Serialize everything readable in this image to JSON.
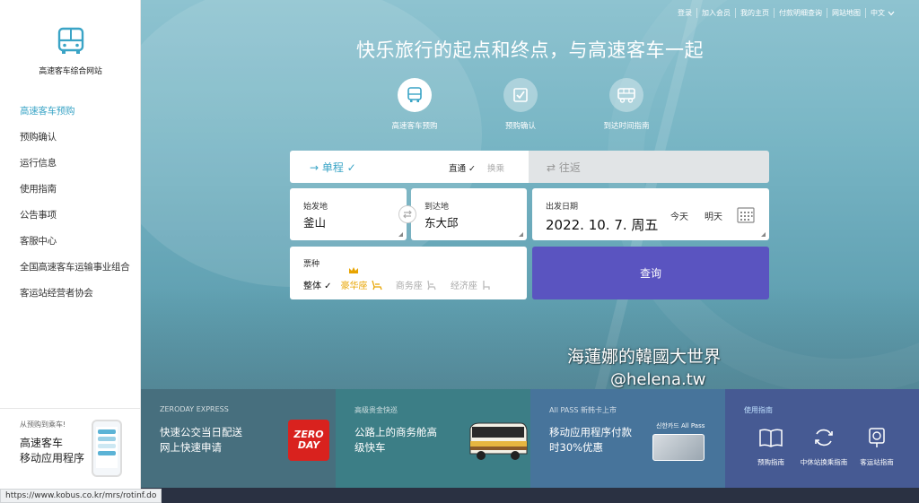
{
  "sidebar": {
    "logo_text": "高速客车综合网站",
    "items": [
      {
        "label": "高速客车预购",
        "active": true
      },
      {
        "label": "预购确认"
      },
      {
        "label": "运行信息"
      },
      {
        "label": "使用指南"
      },
      {
        "label": "公告事项"
      },
      {
        "label": "客服中心"
      },
      {
        "label": "全国高速客车运输事业组合"
      },
      {
        "label": "客运站经营者协会"
      }
    ],
    "promo": {
      "small": "从预购到乘车!",
      "line1": "高速客车",
      "line2": "移动应用程序"
    }
  },
  "topnav": {
    "items": [
      "登录",
      "加入会员",
      "我的主页",
      "付款明细查询",
      "网站地图"
    ],
    "lang": "中文"
  },
  "hero": {
    "headline": "快乐旅行的起点和终点，与高速客车一起",
    "steps": [
      {
        "label": "高速客车预购",
        "icon": "bus-icon",
        "active": true
      },
      {
        "label": "预购确认",
        "icon": "checkbox-icon"
      },
      {
        "label": "到达时间指南",
        "icon": "bus-time-icon"
      }
    ]
  },
  "booking": {
    "oneway_label": "→ 单程 ✓",
    "direct_label": "直通 ✓",
    "transfer_label": "换乘",
    "roundtrip_label": "⇄ 往返",
    "origin_label": "始发地",
    "origin_value": "釜山",
    "dest_label": "到达地",
    "dest_value": "东大邱",
    "date_label": "出发日期",
    "date_value": "2022. 10. 7. 周五",
    "today_label": "今天",
    "tomorrow_label": "明天",
    "ticket_label": "票种",
    "seat_all": "整体 ✓",
    "seat_lux": "豪华座",
    "seat_biz": "商务座",
    "seat_eco": "经济座",
    "search_label": "查询"
  },
  "watermark": {
    "line1": "海蓮娜的韓國大世界",
    "line2": "@helena.tw"
  },
  "banners": [
    {
      "small": "ZERODAY EXPRESS",
      "big1": "快速公交当日配送",
      "big2": "网上快速申请",
      "logo1": "ZERO",
      "logo2": "DAY"
    },
    {
      "small": "高级贵金快巡",
      "big1": "公路上的商务舱高",
      "big2": "级快车"
    },
    {
      "small": "All PASS 新韩卡上市",
      "big1": "移动应用程序付款",
      "big2": "时30%优惠",
      "card_label": "신한카드 All Pass"
    },
    {
      "small": "使用指南",
      "items": [
        "预购指南",
        "中休站换乘指南",
        "客运站指南"
      ]
    }
  ],
  "status_url": "https://www.kobus.co.kr/mrs/rotinf.do",
  "colors": {
    "accent": "#3aa4c6",
    "search_button": "#5a54c0",
    "lux_seat": "#e8a400"
  }
}
